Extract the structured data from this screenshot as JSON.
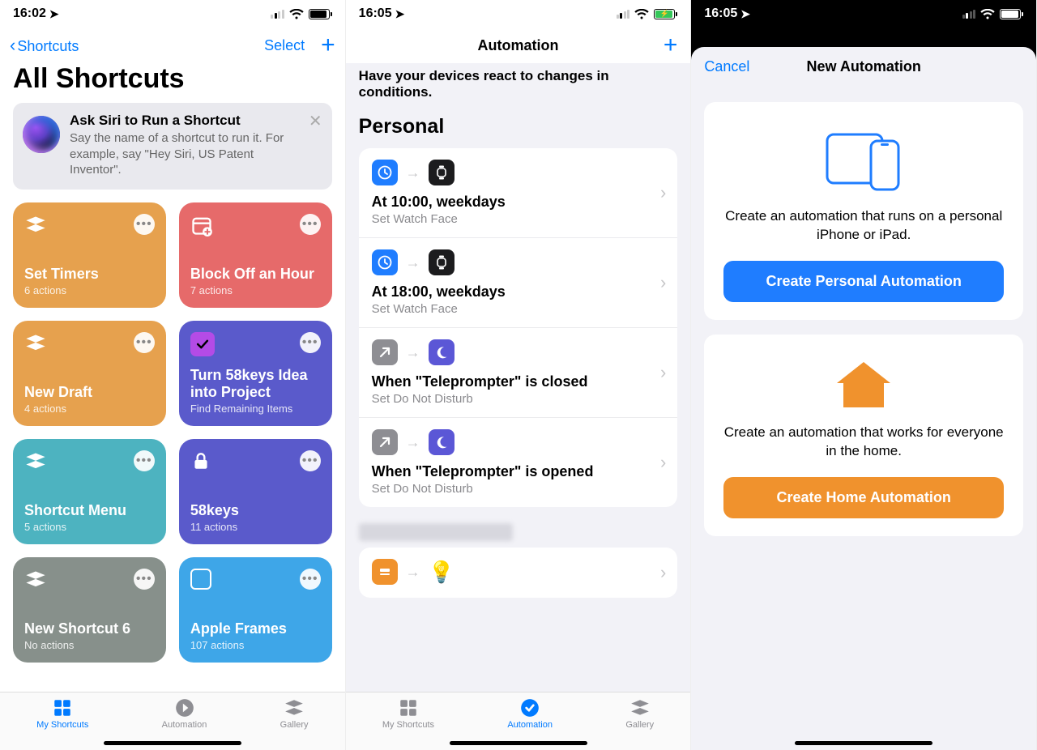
{
  "screen1": {
    "status_time": "16:02",
    "nav_back": "Shortcuts",
    "nav_select": "Select",
    "title": "All Shortcuts",
    "siri": {
      "title": "Ask Siri to Run a Shortcut",
      "sub": "Say the name of a shortcut to run it. For example, say \"Hey Siri, US Patent Inventor\"."
    },
    "cards": [
      {
        "name": "Set Timers",
        "sub": "6 actions",
        "color": "#e6a14e",
        "icon": "stack"
      },
      {
        "name": "Block Off an Hour",
        "sub": "7 actions",
        "color": "#e66a6a",
        "icon": "calendar-plus"
      },
      {
        "name": "New Draft",
        "sub": "4 actions",
        "color": "#e6a14e",
        "icon": "stack"
      },
      {
        "name": "Turn 58keys Idea into Project",
        "sub": "Find Remaining Items",
        "color": "#5a5acb",
        "icon": "check-sheet"
      },
      {
        "name": "Shortcut Menu",
        "sub": "5 actions",
        "color": "#4db3c0",
        "icon": "stack"
      },
      {
        "name": "58keys",
        "sub": "11 actions",
        "color": "#5a5acb",
        "icon": "lock"
      },
      {
        "name": "New Shortcut 6",
        "sub": "No actions",
        "color": "#87908b",
        "icon": "stack"
      },
      {
        "name": "Apple Frames",
        "sub": "107 actions",
        "color": "#3ea6e8",
        "icon": "square"
      }
    ],
    "tabs": {
      "my": "My Shortcuts",
      "auto": "Automation",
      "gallery": "Gallery",
      "active": "my"
    }
  },
  "screen2": {
    "status_time": "16:05",
    "nav_title": "Automation",
    "intro": "Have your devices react to changes in conditions.",
    "section": "Personal",
    "items": [
      {
        "title": "At 10:00, weekdays",
        "sub": "Set Watch Face",
        "trigger": "clock",
        "action": "watch"
      },
      {
        "title": "At 18:00, weekdays",
        "sub": "Set Watch Face",
        "trigger": "clock",
        "action": "watch"
      },
      {
        "title": "When \"Teleprompter\" is closed",
        "sub": "Set Do Not Disturb",
        "trigger": "app-arrow",
        "action": "moon"
      },
      {
        "title": "When \"Teleprompter\" is opened",
        "sub": "Set Do Not Disturb",
        "trigger": "app-arrow",
        "action": "moon"
      }
    ],
    "peek": {
      "trigger": "nfc",
      "action": "bulb"
    },
    "tabs": {
      "my": "My Shortcuts",
      "auto": "Automation",
      "gallery": "Gallery",
      "active": "auto"
    }
  },
  "screen3": {
    "status_time": "16:05",
    "cancel": "Cancel",
    "title": "New Automation",
    "personal": {
      "desc": "Create an automation that runs on a personal iPhone or iPad.",
      "button": "Create Personal Automation"
    },
    "home": {
      "desc": "Create an automation that works for everyone in the home.",
      "button": "Create Home Automation"
    }
  }
}
